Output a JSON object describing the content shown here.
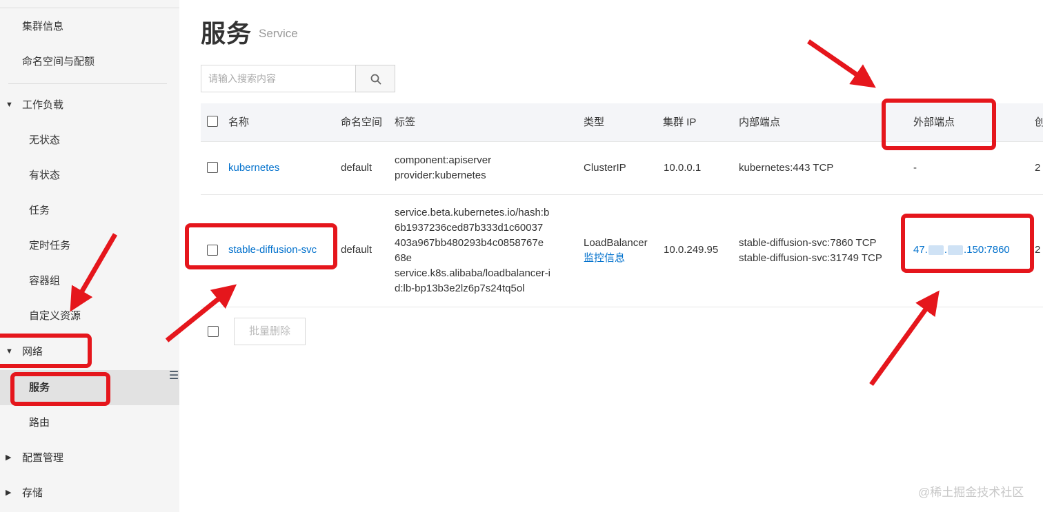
{
  "sidebar": {
    "items": [
      {
        "label": "集群信息"
      },
      {
        "label": "命名空间与配额"
      },
      {
        "label": "工作负载"
      },
      {
        "label": "无状态"
      },
      {
        "label": "有状态"
      },
      {
        "label": "任务"
      },
      {
        "label": "定时任务"
      },
      {
        "label": "容器组"
      },
      {
        "label": "自定义资源"
      },
      {
        "label": "网络"
      },
      {
        "label": "服务"
      },
      {
        "label": "路由"
      },
      {
        "label": "配置管理"
      },
      {
        "label": "存储"
      }
    ],
    "collapse_icon": "list-collapse-icon"
  },
  "page": {
    "title": "服务",
    "subtitle": "Service"
  },
  "search": {
    "placeholder": "请输入搜索内容",
    "value": "",
    "icon": "search-icon"
  },
  "table": {
    "columns": [
      "名称",
      "命名空间",
      "标签",
      "类型",
      "集群 IP",
      "内部端点",
      "外部端点",
      "创"
    ],
    "rows": [
      {
        "name": "kubernetes",
        "namespace": "default",
        "labels": [
          "component:apiserver",
          "provider:kubernetes"
        ],
        "type": "ClusterIP",
        "type_link": "",
        "cluster_ip": "10.0.0.1",
        "internal_endpoints": [
          "kubernetes:443 TCP"
        ],
        "external_endpoint": "-",
        "created": "2"
      },
      {
        "name": "stable-diffusion-svc",
        "namespace": "default",
        "labels": [
          "service.beta.kubernetes.io/hash:b",
          "6b1937236ced87b333d1c60037",
          "403a967bb480293b4c0858767e",
          "68e",
          "service.k8s.alibaba/loadbalancer-i",
          "d:lb-bp13b3e2lz6p7s24tq5ol"
        ],
        "type": "LoadBalancer",
        "type_link": "监控信息",
        "cluster_ip": "10.0.249.95",
        "internal_endpoints": [
          "stable-diffusion-svc:7860 TCP",
          "stable-diffusion-svc:31749 TCP"
        ],
        "external_endpoint_prefix": "47.",
        "external_endpoint_suffix": ".150:7860",
        "created": "2"
      }
    ]
  },
  "bulk_delete": {
    "label": "批量删除"
  },
  "watermark": "@稀土掘金技术社区",
  "colors": {
    "link": "#0070cc",
    "annotation": "#e5161c",
    "sidebar_bg": "#f5f5f5",
    "header_bg": "#f4f5f8"
  }
}
